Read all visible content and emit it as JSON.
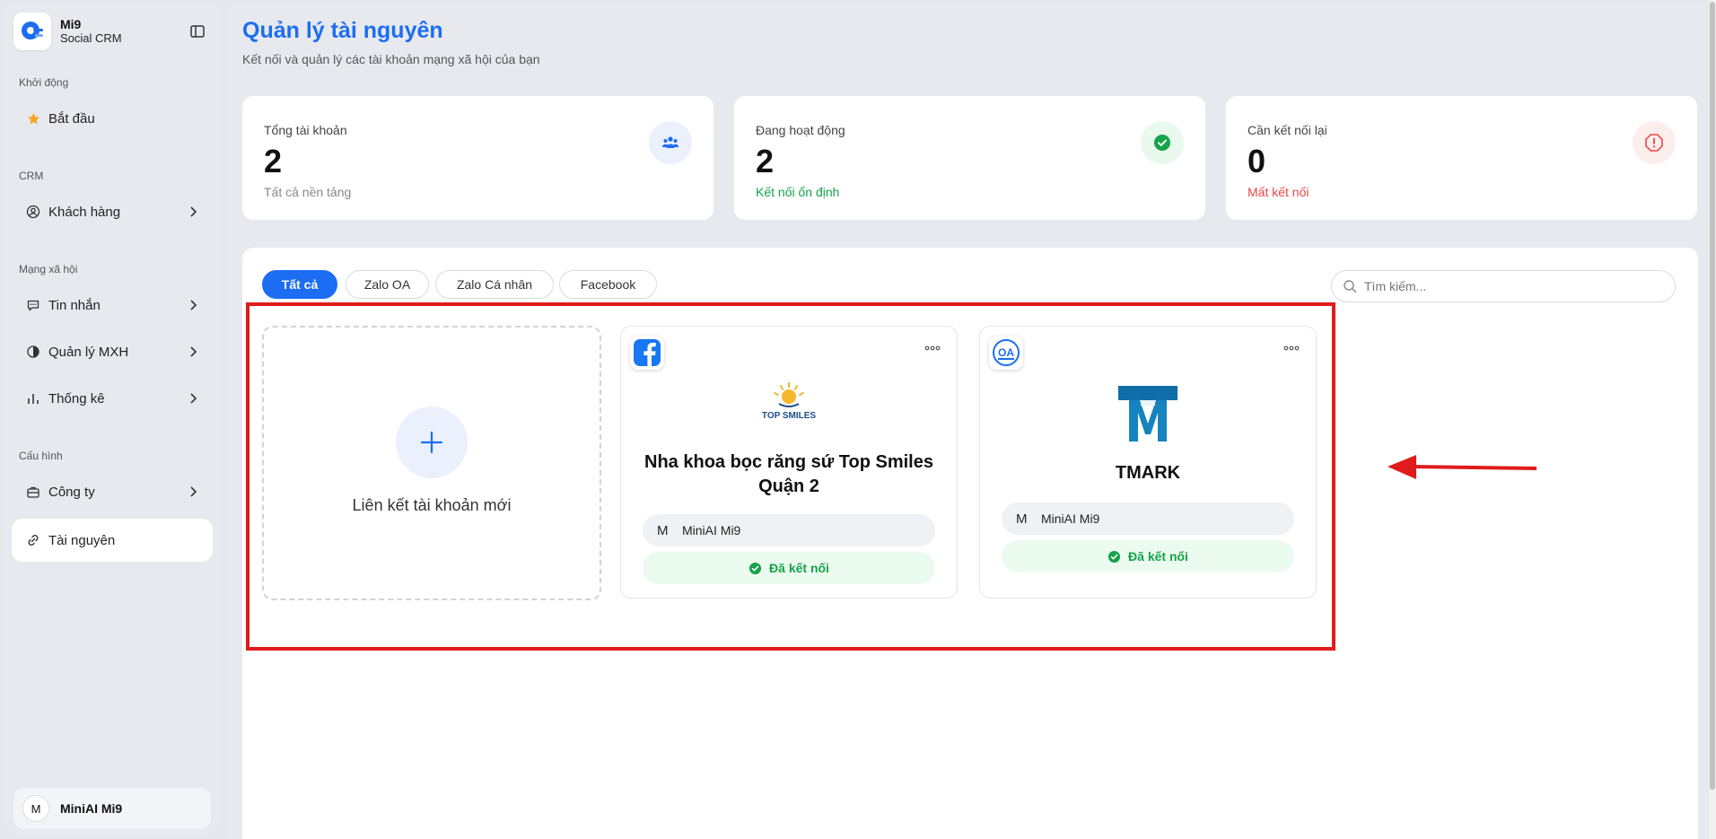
{
  "sidebar": {
    "brand": {
      "name": "Mi9",
      "subtitle": "Social CRM"
    },
    "sections": [
      {
        "label": "Khởi động",
        "items": [
          {
            "label": "Bắt đầu",
            "icon": "star-icon"
          }
        ]
      },
      {
        "label": "CRM",
        "items": [
          {
            "label": "Khách hàng",
            "icon": "user-circle-icon"
          }
        ]
      },
      {
        "label": "Mạng xã hội",
        "items": [
          {
            "label": "Tin nhắn",
            "icon": "message-icon"
          },
          {
            "label": "Quản lý MXH",
            "icon": "pie-icon"
          },
          {
            "label": "Thống kê",
            "icon": "bar-chart-icon"
          }
        ]
      },
      {
        "label": "Cấu hình",
        "items": [
          {
            "label": "Công ty",
            "icon": "briefcase-icon"
          },
          {
            "label": "Tài nguyên",
            "icon": "link-icon",
            "active": true
          }
        ]
      }
    ],
    "user": {
      "initial": "M",
      "name": "MiniAI Mi9"
    }
  },
  "header": {
    "title": "Quản lý tài nguyên",
    "subtitle": "Kết nối và quản lý các tài khoản mạng xã hội của bạn"
  },
  "stats": [
    {
      "label": "Tổng tài khoản",
      "value": "2",
      "note": "Tất cả nền tảng",
      "note_color": "#888888",
      "icon": "users-icon",
      "badge_bg": "#eaf1fd"
    },
    {
      "label": "Đang hoạt động",
      "value": "2",
      "note": "Kết nối ổn định",
      "note_color": "#16a34a",
      "icon": "check-circle-icon",
      "badge_bg": "#e9f9ee"
    },
    {
      "label": "Cần kết nối lại",
      "value": "0",
      "note": "Mất kết nối",
      "note_color": "#ef4444",
      "icon": "alert-octagon-icon",
      "badge_bg": "#fdeeee"
    }
  ],
  "filters": {
    "tabs": [
      "Tất cả",
      "Zalo OA",
      "Zalo Cá nhân",
      "Facebook"
    ],
    "active_tab": "Tất cả",
    "search_placeholder": "Tìm kiếm..."
  },
  "add_card": {
    "label": "Liên kết tài khoản mới"
  },
  "accounts": [
    {
      "platform": "Facebook",
      "platform_icon": "facebook-icon",
      "logo_text": "TOP SMILES",
      "name": "Nha khoa bọc răng sứ Top Smiles Quận 2",
      "owner_initial": "M",
      "owner": "MiniAI Mi9",
      "status": "Đã kết nối"
    },
    {
      "platform": "Zalo OA",
      "platform_icon": "zalo-oa-icon",
      "logo_text": "",
      "name": "TMARK",
      "owner_initial": "M",
      "owner": "MiniAI Mi9",
      "status": "Đã kết nối"
    }
  ],
  "colors": {
    "accent": "#1d6df2",
    "success": "#16a34a",
    "danger": "#ef4444",
    "annotation": "#e01b1b"
  }
}
